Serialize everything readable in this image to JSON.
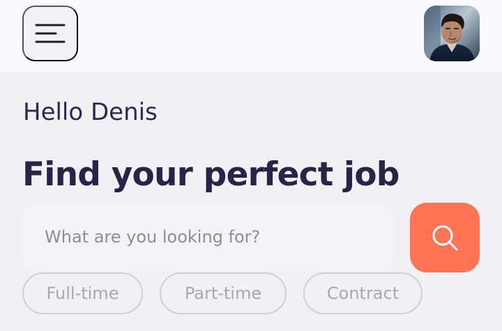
{
  "header": {
    "menu_icon": "menu-icon",
    "avatar_icon": "profile-avatar"
  },
  "greeting": {
    "hello": "Hello Denis",
    "title": "Find your perfect job"
  },
  "search": {
    "placeholder": "What are you looking for?",
    "value": "",
    "button_icon": "search-icon"
  },
  "filters": [
    {
      "label": "Full-time"
    },
    {
      "label": "Part-time"
    },
    {
      "label": "Contract"
    }
  ],
  "colors": {
    "primary_text": "#2b2247",
    "search_button": "#ff7454",
    "chip_border": "#cfcfd4",
    "chip_text": "#a8a8af"
  }
}
